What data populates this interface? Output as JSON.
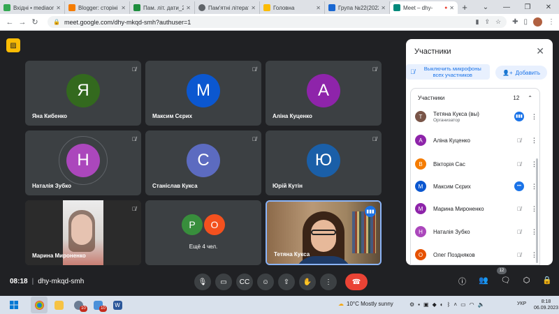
{
  "browser": {
    "tabs": [
      {
        "label": "Вхідні • mediaon",
        "color": "#34a853"
      },
      {
        "label": "Blogger: сторіні",
        "color": "#f57c00"
      },
      {
        "label": "Пам. літ. дати_20",
        "color": "#1e8e3e"
      },
      {
        "label": "Пам'ятні літерат",
        "color": "#5f6368"
      },
      {
        "label": "Головна",
        "color": "#fbbc04"
      },
      {
        "label": "Група №22(2022",
        "color": "#1967d2"
      },
      {
        "label": "Meet – dhy-",
        "color": "#00897b"
      }
    ],
    "url": "meet.google.com/dhy-mkqd-smh?authuser=1"
  },
  "tiles": [
    {
      "initial": "Я",
      "name": "Яна Кибенко",
      "color": "#33691e"
    },
    {
      "initial": "М",
      "name": "Максим Сєрих",
      "color": "#0b57d0"
    },
    {
      "initial": "А",
      "name": "Аліна Куценко",
      "color": "#8e24aa"
    },
    {
      "initial": "Н",
      "name": "Наталія Зубко",
      "color": "#ab47bc"
    },
    {
      "initial": "С",
      "name": "Станіслав Кукса",
      "color": "#5c6bc0"
    },
    {
      "initial": "Ю",
      "name": "Юрій Кутін",
      "color": "#1a5fa8"
    },
    {
      "name": "Марина Мироненко"
    },
    {
      "more_label": "Ещё 4 чел.",
      "initials": [
        "Р",
        "О"
      ],
      "colors": [
        "#388e3c",
        "#f4511e"
      ]
    },
    {
      "name": "Тетяна Кукса"
    }
  ],
  "toolbar": {
    "time": "08:18",
    "code": "dhy-mkqd-smh",
    "participant_count": "12"
  },
  "panel": {
    "title": "Участники",
    "mute_all": "Выключить микрофоны всех участников",
    "add": "Добавить",
    "list_header": "Участники",
    "list_count": "12",
    "people": [
      {
        "initial": "Т",
        "name": "Тетяна Кукса (вы)",
        "role": "Организатор",
        "color": "#795548",
        "status": "live"
      },
      {
        "initial": "А",
        "name": "Аліна Куценко",
        "color": "#8e24aa",
        "status": "muted"
      },
      {
        "initial": "В",
        "name": "Вікторія Сас",
        "color": "#f57c00",
        "status": "muted"
      },
      {
        "initial": "М",
        "name": "Максим Сєрих",
        "color": "#0b57d0",
        "status": "live"
      },
      {
        "initial": "М",
        "name": "Марина Мироненко",
        "color": "#8e24aa",
        "status": "muted"
      },
      {
        "initial": "Н",
        "name": "Наталія Зубко",
        "color": "#ab47bc",
        "status": "muted"
      },
      {
        "initial": "О",
        "name": "Олег Поздняков",
        "color": "#e65100",
        "status": "muted"
      }
    ]
  },
  "taskbar": {
    "weather": "10°C  Mostly sunny",
    "lang": "УКР",
    "time": "8:18",
    "date": "06.09.2023",
    "badges": [
      "10",
      "10"
    ]
  }
}
